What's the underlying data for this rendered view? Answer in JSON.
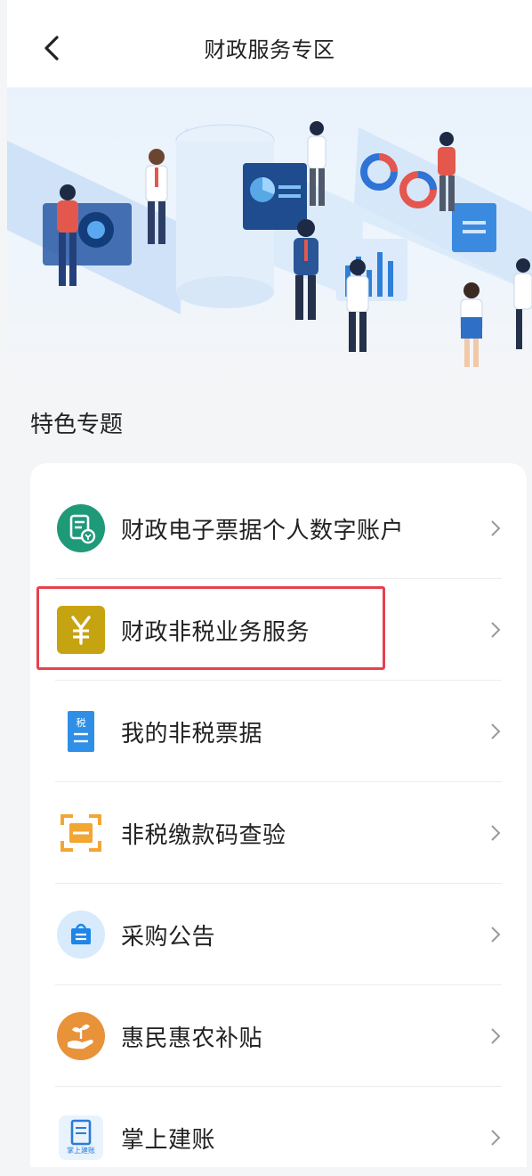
{
  "header": {
    "title": "财政服务专区",
    "back_icon": "chevron-left-icon"
  },
  "section": {
    "title": "特色专题"
  },
  "items": [
    {
      "label": "财政电子票据个人数字账户",
      "icon": "receipt-account-icon",
      "color": "#1f9a78"
    },
    {
      "label": "财政非税业务服务",
      "icon": "yuan-icon",
      "color": "#c6a310",
      "highlighted": true
    },
    {
      "label": "我的非税票据",
      "icon": "tax-document-icon",
      "color": "#2f8fe6"
    },
    {
      "label": "非税缴款码查验",
      "icon": "scan-code-icon",
      "color": "#f2a634"
    },
    {
      "label": "采购公告",
      "icon": "shopping-bag-icon",
      "color": "#1d86e8"
    },
    {
      "label": "惠民惠农补贴",
      "icon": "hand-sprout-icon",
      "color": "#e8923a"
    },
    {
      "label": "掌上建账",
      "icon": "handbook-icon",
      "color": "#2a7cd6",
      "badge": "掌上建账"
    }
  ],
  "colors": {
    "background": "#f4f5f7",
    "card": "#ffffff",
    "highlight": "#e5424d"
  }
}
